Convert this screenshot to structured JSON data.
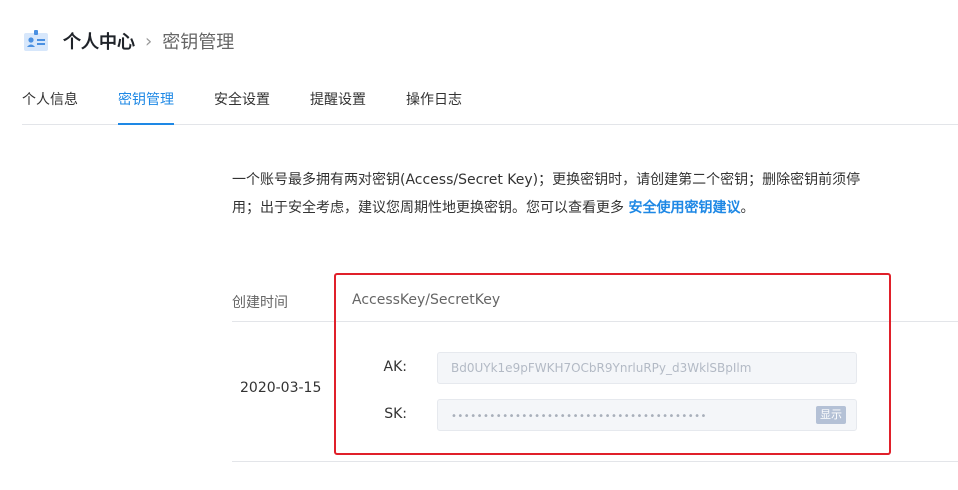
{
  "header": {
    "title": "个人中心",
    "separator": "›",
    "crumb": "密钥管理",
    "icon": "id-card-icon",
    "accent": "#4a90e2"
  },
  "tabs": [
    {
      "label": "个人信息",
      "active": false
    },
    {
      "label": "密钥管理",
      "active": true
    },
    {
      "label": "安全设置",
      "active": false
    },
    {
      "label": "提醒设置",
      "active": false
    },
    {
      "label": "操作日志",
      "active": false
    }
  ],
  "notice": {
    "text": "一个账号最多拥有两对密钥(Access/Secret Key)；更换密钥时，请创建第二个密钥；删除密钥前须停用；出于安全考虑，建议您周期性地更换密钥。您可以查看更多 ",
    "link": "安全使用密钥建议",
    "suffix": "。"
  },
  "table": {
    "col_time": "创建时间",
    "col_key": "AccessKey/SecretKey",
    "row": {
      "date": "2020-03-15",
      "ak_label": "AK:",
      "ak_value": "Bd0UYk1e9pFWKH7OCbR9YnrluRPy_d3WklSBpIlm",
      "sk_label": "SK:",
      "sk_value": "••••••••••••••••••••••••••••••••••••••••",
      "show_label": "显示"
    }
  },
  "colors": {
    "link": "#1e88e5",
    "highlight": "#e0202a"
  }
}
